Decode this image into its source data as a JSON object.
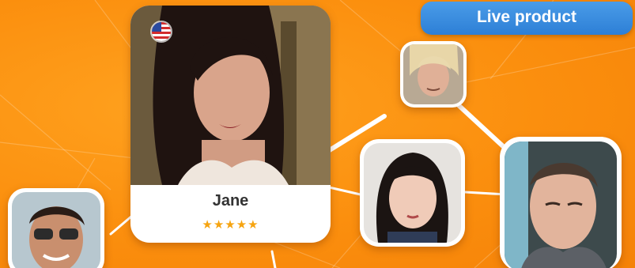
{
  "badge": {
    "label": "Live product"
  },
  "main_profile": {
    "name": "Jane",
    "rating": "★★★★★",
    "flag": "us-flag-icon"
  },
  "colors": {
    "background": "#fb8f0e",
    "badge": "#2d7fd6",
    "star": "#f6a410",
    "card": "#ffffff"
  }
}
